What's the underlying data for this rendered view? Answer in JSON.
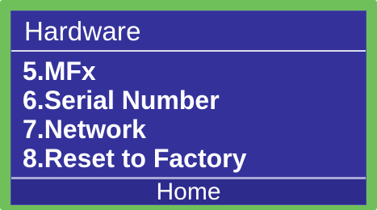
{
  "screen": {
    "title": "Hardware",
    "menu_items": [
      {
        "label": "5.MFx"
      },
      {
        "label": "6.Serial Number"
      },
      {
        "label": "7.Network"
      },
      {
        "label": "8.Reset to Factory"
      }
    ],
    "footer": {
      "home_label": "Home"
    }
  },
  "colors": {
    "bezel": "#6fc05a",
    "screen_background": "#34329a",
    "text": "#ffffff",
    "divider": "#dcdcf0"
  }
}
